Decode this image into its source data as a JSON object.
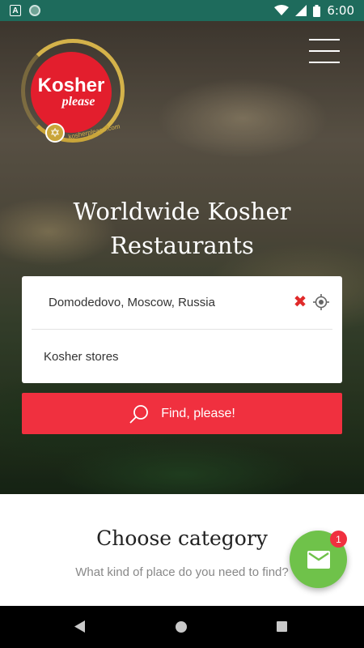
{
  "status_bar": {
    "time": "6:00",
    "left_badge": "A"
  },
  "logo": {
    "word": "Kosher",
    "sub": "please",
    "url": "kosherplease.com"
  },
  "hero": {
    "headline_line1": "Worldwide Kosher",
    "headline_line2": "Restaurants"
  },
  "search": {
    "location_value": "Domodedovo, Moscow, Russia",
    "category_value": "Kosher stores",
    "find_label": "Find, please!"
  },
  "category": {
    "title": "Choose category",
    "subtitle": "What kind of place do you need to find?"
  },
  "fab": {
    "badge_count": "1"
  },
  "colors": {
    "status_bar": "#1e6b5c",
    "accent_red": "#f0303f",
    "fab_green": "#6fc24a",
    "logo_gold": "#d4b24a"
  }
}
